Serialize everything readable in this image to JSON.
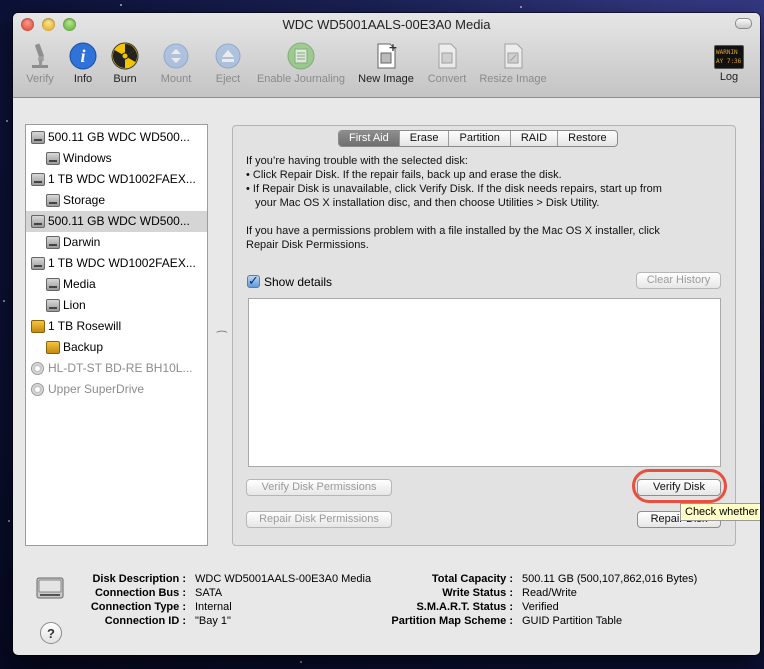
{
  "window": {
    "title": "WDC WD5001AALS-00E3A0 Media"
  },
  "toolbar": {
    "items": [
      {
        "label": "Verify",
        "icon": "microscope-icon",
        "enabled": false
      },
      {
        "label": "Info",
        "icon": "info-icon",
        "enabled": true
      },
      {
        "label": "Burn",
        "icon": "burn-icon",
        "enabled": true
      },
      {
        "label": "Mount",
        "icon": "mount-icon",
        "enabled": false
      },
      {
        "label": "Eject",
        "icon": "eject-icon",
        "enabled": false
      },
      {
        "label": "Enable Journaling",
        "icon": "journaling-icon",
        "enabled": false
      },
      {
        "label": "New Image",
        "icon": "new-image-icon",
        "enabled": true
      },
      {
        "label": "Convert",
        "icon": "convert-icon",
        "enabled": false
      },
      {
        "label": "Resize Image",
        "icon": "resize-image-icon",
        "enabled": false
      },
      {
        "label": "Log",
        "icon": "log-icon",
        "enabled": true
      }
    ],
    "log_icon_text": "WARNIN\nAY 7:36"
  },
  "sidebar": {
    "items": [
      {
        "label": "500.11 GB WDC WD500...",
        "type": "disk",
        "icon": "hard-disk-icon",
        "level": 0,
        "selected": false,
        "dimmed": false
      },
      {
        "label": "Windows",
        "type": "volume",
        "icon": "hard-disk-icon",
        "level": 1,
        "selected": false,
        "dimmed": false
      },
      {
        "label": "1 TB WDC WD1002FAEX...",
        "type": "disk",
        "icon": "hard-disk-icon",
        "level": 0,
        "selected": false,
        "dimmed": false
      },
      {
        "label": "Storage",
        "type": "volume",
        "icon": "hard-disk-icon",
        "level": 1,
        "selected": false,
        "dimmed": false
      },
      {
        "label": "500.11 GB WDC WD500...",
        "type": "disk",
        "icon": "hard-disk-icon",
        "level": 0,
        "selected": true,
        "dimmed": false
      },
      {
        "label": "Darwin",
        "type": "volume",
        "icon": "hard-disk-icon",
        "level": 1,
        "selected": false,
        "dimmed": false
      },
      {
        "label": "1 TB WDC WD1002FAEX...",
        "type": "disk",
        "icon": "hard-disk-icon",
        "level": 0,
        "selected": false,
        "dimmed": false
      },
      {
        "label": "Media",
        "type": "volume",
        "icon": "hard-disk-icon",
        "level": 1,
        "selected": false,
        "dimmed": false
      },
      {
        "label": "Lion",
        "type": "volume",
        "icon": "hard-disk-icon",
        "level": 1,
        "selected": false,
        "dimmed": false
      },
      {
        "label": "1 TB Rosewill",
        "type": "disk",
        "icon": "external-disk-icon",
        "level": 0,
        "selected": false,
        "dimmed": false
      },
      {
        "label": "Backup",
        "type": "volume",
        "icon": "external-disk-icon",
        "level": 1,
        "selected": false,
        "dimmed": false
      },
      {
        "label": "HL-DT-ST BD-RE BH10L...",
        "type": "optical",
        "icon": "optical-drive-icon",
        "level": 0,
        "selected": false,
        "dimmed": true
      },
      {
        "label": "Upper SuperDrive",
        "type": "optical",
        "icon": "optical-drive-icon",
        "level": 0,
        "selected": false,
        "dimmed": true
      }
    ]
  },
  "tabs": [
    {
      "label": "First Aid",
      "active": true
    },
    {
      "label": "Erase",
      "active": false
    },
    {
      "label": "Partition",
      "active": false
    },
    {
      "label": "RAID",
      "active": false
    },
    {
      "label": "Restore",
      "active": false
    }
  ],
  "first_aid": {
    "info_lines": [
      "If you’re having trouble with the selected disk:",
      "• Click Repair Disk. If the repair fails, back up and erase the disk.",
      "• If Repair Disk is unavailable, click Verify Disk. If the disk needs repairs, start up from",
      "   your Mac OS X installation disc, and then choose Utilities > Disk Utility."
    ],
    "perm_lines": [
      "If you have a permissions problem with a file installed by the Mac OS X installer, click",
      "Repair Disk Permissions."
    ],
    "show_details_label": "Show details",
    "show_details_checked": true,
    "clear_history_label": "Clear History",
    "verify_permissions_label": "Verify Disk Permissions",
    "repair_permissions_label": "Repair Disk Permissions",
    "verify_disk_label": "Verify Disk",
    "repair_disk_label": "Repair Disk",
    "tooltip": "Check whether"
  },
  "details": {
    "left": [
      {
        "key": "Disk Description :",
        "value": "WDC WD5001AALS-00E3A0 Media"
      },
      {
        "key": "Connection Bus :",
        "value": "SATA"
      },
      {
        "key": "Connection Type :",
        "value": "Internal"
      },
      {
        "key": "Connection ID :",
        "value": "\"Bay 1\""
      }
    ],
    "right": [
      {
        "key": "Total Capacity :",
        "value": "500.11 GB (500,107,862,016 Bytes)"
      },
      {
        "key": "Write Status :",
        "value": "Read/Write"
      },
      {
        "key": "S.M.A.R.T. Status :",
        "value": "Verified"
      },
      {
        "key": "Partition Map Scheme :",
        "value": "GUID Partition Table"
      }
    ],
    "help_label": "?"
  },
  "colors": {
    "highlight_ring": "#e94f3e",
    "tooltip_bg": "#ffffc7",
    "selection": "#d5d5d5"
  }
}
